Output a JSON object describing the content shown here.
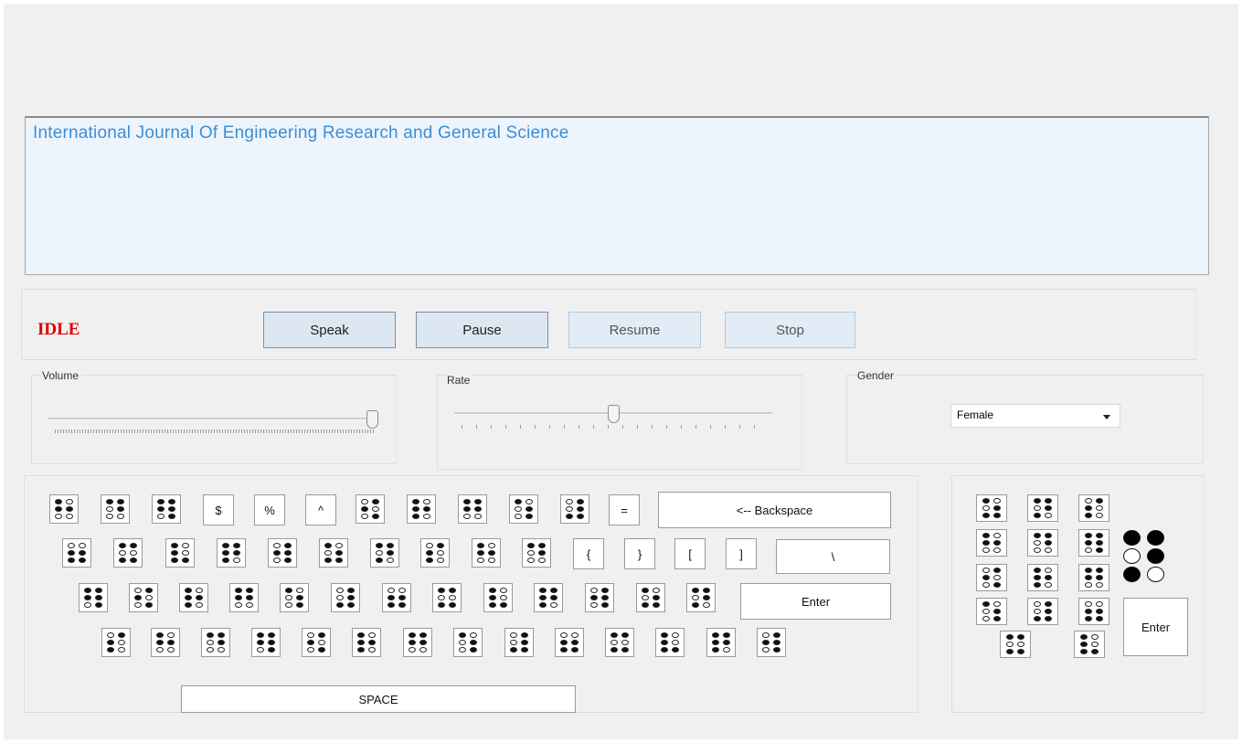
{
  "text_area": {
    "value": "International Journal Of Engineering Research and General Science"
  },
  "status": {
    "label": "IDLE",
    "color": "#e00000"
  },
  "controls": {
    "speak": "Speak",
    "pause": "Pause",
    "resume": "Resume",
    "stop": "Stop",
    "resume_enabled": false,
    "stop_enabled": false
  },
  "volume": {
    "label": "Volume",
    "level_percent": 100
  },
  "rate": {
    "label": "Rate",
    "level_percent": 50
  },
  "gender": {
    "label": "Gender",
    "selected": "Female"
  },
  "keyboard": {
    "symbol_keys": [
      "$",
      "%",
      "^",
      "=",
      "{",
      "}",
      "[",
      "]",
      "\\"
    ],
    "backspace": "<--   Backspace",
    "enter": "Enter",
    "space": "SPACE"
  },
  "side_keypad": {
    "enter": "Enter"
  },
  "colors": {
    "panel_bg": "#f0f0f0",
    "text_area_bg": "#eef4fb",
    "text_color": "#3b8ed6",
    "button_bg": "#dce7f2"
  }
}
